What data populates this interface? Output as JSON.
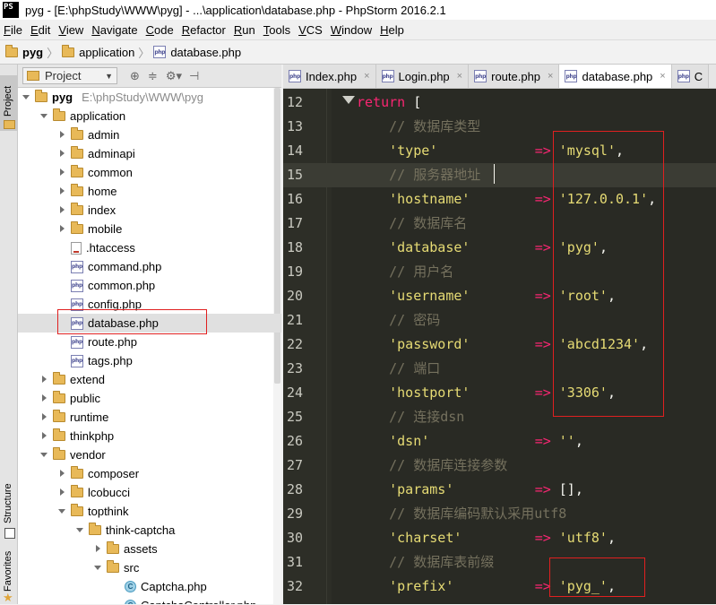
{
  "window": {
    "app_icon": "PS",
    "title": "pyg - [E:\\phpStudy\\WWW\\pyg] - ...\\application\\database.php - PhpStorm 2016.2.1"
  },
  "menu": [
    "File",
    "Edit",
    "View",
    "Navigate",
    "Code",
    "Refactor",
    "Run",
    "Tools",
    "VCS",
    "Window",
    "Help"
  ],
  "breadcrumb": [
    "pyg",
    "application",
    "database.php"
  ],
  "side_tabs": {
    "project": "Project",
    "structure": "Structure",
    "favorites": "Favorites"
  },
  "project_panel": {
    "title": "Project",
    "tree": [
      {
        "label": "pyg",
        "path": "E:\\phpStudy\\WWW\\pyg",
        "type": "folder",
        "expanded": true,
        "depth": 0
      },
      {
        "label": "application",
        "type": "folder",
        "expanded": true,
        "depth": 1
      },
      {
        "label": "admin",
        "type": "folder",
        "expanded": false,
        "depth": 2
      },
      {
        "label": "adminapi",
        "type": "folder",
        "expanded": false,
        "depth": 2
      },
      {
        "label": "common",
        "type": "folder",
        "expanded": false,
        "depth": 2
      },
      {
        "label": "home",
        "type": "folder",
        "expanded": false,
        "depth": 2
      },
      {
        "label": "index",
        "type": "folder",
        "expanded": false,
        "depth": 2
      },
      {
        "label": "mobile",
        "type": "folder",
        "expanded": false,
        "depth": 2
      },
      {
        "label": ".htaccess",
        "type": "htaccess",
        "depth": 2
      },
      {
        "label": "command.php",
        "type": "php",
        "depth": 2
      },
      {
        "label": "common.php",
        "type": "php",
        "depth": 2
      },
      {
        "label": "config.php",
        "type": "php",
        "depth": 2
      },
      {
        "label": "database.php",
        "type": "php",
        "depth": 2,
        "selected": true
      },
      {
        "label": "route.php",
        "type": "php",
        "depth": 2
      },
      {
        "label": "tags.php",
        "type": "php",
        "depth": 2
      },
      {
        "label": "extend",
        "type": "folder",
        "expanded": false,
        "depth": 1
      },
      {
        "label": "public",
        "type": "folder",
        "expanded": false,
        "depth": 1
      },
      {
        "label": "runtime",
        "type": "folder",
        "expanded": false,
        "depth": 1
      },
      {
        "label": "thinkphp",
        "type": "folder",
        "expanded": false,
        "depth": 1
      },
      {
        "label": "vendor",
        "type": "folder",
        "expanded": true,
        "depth": 1
      },
      {
        "label": "composer",
        "type": "folder",
        "expanded": false,
        "depth": 2
      },
      {
        "label": "lcobucci",
        "type": "folder",
        "expanded": false,
        "depth": 2
      },
      {
        "label": "topthink",
        "type": "folder",
        "expanded": true,
        "depth": 2
      },
      {
        "label": "think-captcha",
        "type": "folder",
        "expanded": true,
        "depth": 3
      },
      {
        "label": "assets",
        "type": "folder",
        "expanded": false,
        "depth": 4
      },
      {
        "label": "src",
        "type": "folder",
        "expanded": true,
        "depth": 4
      },
      {
        "label": "Captcha.php",
        "type": "class",
        "depth": 5
      },
      {
        "label": "CaptchaController.php",
        "type": "class",
        "depth": 5
      }
    ]
  },
  "tabs": [
    {
      "label": "Index.php",
      "active": false
    },
    {
      "label": "Login.php",
      "active": false
    },
    {
      "label": "route.php",
      "active": false
    },
    {
      "label": "database.php",
      "active": true
    },
    {
      "label": "C",
      "active": false
    }
  ],
  "code_lines": [
    {
      "n": "12",
      "tokens": [
        [
          "kw",
          "return"
        ],
        [
          "pl",
          " ["
        ]
      ]
    },
    {
      "n": "13",
      "tokens": [
        [
          "cm",
          "    // 数据库类型"
        ]
      ]
    },
    {
      "n": "14",
      "tokens": [
        [
          "str",
          "    'type'"
        ],
        [
          "pl",
          "            "
        ],
        [
          "op",
          "=>"
        ],
        [
          "pl",
          " "
        ],
        [
          "str",
          "'mysql'"
        ],
        [
          "pl",
          ","
        ]
      ]
    },
    {
      "n": "15",
      "tokens": [
        [
          "cm",
          "    // 服务器地址"
        ]
      ],
      "current": true
    },
    {
      "n": "16",
      "tokens": [
        [
          "str",
          "    'hostname'"
        ],
        [
          "pl",
          "        "
        ],
        [
          "op",
          "=>"
        ],
        [
          "pl",
          " "
        ],
        [
          "str",
          "'127.0.0.1'"
        ],
        [
          "pl",
          ","
        ]
      ]
    },
    {
      "n": "17",
      "tokens": [
        [
          "cm",
          "    // 数据库名"
        ]
      ]
    },
    {
      "n": "18",
      "tokens": [
        [
          "str",
          "    'database'"
        ],
        [
          "pl",
          "        "
        ],
        [
          "op",
          "=>"
        ],
        [
          "pl",
          " "
        ],
        [
          "str",
          "'pyg'"
        ],
        [
          "pl",
          ","
        ]
      ]
    },
    {
      "n": "19",
      "tokens": [
        [
          "cm",
          "    // 用户名"
        ]
      ]
    },
    {
      "n": "20",
      "tokens": [
        [
          "str",
          "    'username'"
        ],
        [
          "pl",
          "        "
        ],
        [
          "op",
          "=>"
        ],
        [
          "pl",
          " "
        ],
        [
          "str",
          "'root'"
        ],
        [
          "pl",
          ","
        ]
      ]
    },
    {
      "n": "21",
      "tokens": [
        [
          "cm",
          "    // 密码"
        ]
      ]
    },
    {
      "n": "22",
      "tokens": [
        [
          "str",
          "    'password'"
        ],
        [
          "pl",
          "        "
        ],
        [
          "op",
          "=>"
        ],
        [
          "pl",
          " "
        ],
        [
          "str",
          "'abcd1234'"
        ],
        [
          "pl",
          ","
        ]
      ]
    },
    {
      "n": "23",
      "tokens": [
        [
          "cm",
          "    // 端口"
        ]
      ]
    },
    {
      "n": "24",
      "tokens": [
        [
          "str",
          "    'hostport'"
        ],
        [
          "pl",
          "        "
        ],
        [
          "op",
          "=>"
        ],
        [
          "pl",
          " "
        ],
        [
          "str",
          "'3306'"
        ],
        [
          "pl",
          ","
        ]
      ]
    },
    {
      "n": "25",
      "tokens": [
        [
          "cm",
          "    // 连接dsn"
        ]
      ]
    },
    {
      "n": "26",
      "tokens": [
        [
          "str",
          "    'dsn'"
        ],
        [
          "pl",
          "             "
        ],
        [
          "op",
          "=>"
        ],
        [
          "pl",
          " "
        ],
        [
          "str",
          "''"
        ],
        [
          "pl",
          ","
        ]
      ]
    },
    {
      "n": "27",
      "tokens": [
        [
          "cm",
          "    // 数据库连接参数"
        ]
      ]
    },
    {
      "n": "28",
      "tokens": [
        [
          "str",
          "    'params'"
        ],
        [
          "pl",
          "          "
        ],
        [
          "op",
          "=>"
        ],
        [
          "pl",
          " [],"
        ]
      ]
    },
    {
      "n": "29",
      "tokens": [
        [
          "cm",
          "    // 数据库编码默认采用utf8"
        ]
      ]
    },
    {
      "n": "30",
      "tokens": [
        [
          "str",
          "    'charset'"
        ],
        [
          "pl",
          "         "
        ],
        [
          "op",
          "=>"
        ],
        [
          "pl",
          " "
        ],
        [
          "str",
          "'utf8'"
        ],
        [
          "pl",
          ","
        ]
      ]
    },
    {
      "n": "31",
      "tokens": [
        [
          "cm",
          "    // 数据库表前缀"
        ]
      ]
    },
    {
      "n": "32",
      "tokens": [
        [
          "str",
          "    'prefix'"
        ],
        [
          "pl",
          "          "
        ],
        [
          "op",
          "=>"
        ],
        [
          "pl",
          " "
        ],
        [
          "str",
          "'pyg_'"
        ],
        [
          "pl",
          ","
        ]
      ]
    }
  ],
  "colors": {
    "editor_bg": "#292a24",
    "keyword": "#f92672",
    "string": "#e6db74",
    "comment": "#75715e",
    "highlight_box": "#e02020",
    "selection_bg": "#e0e0e0"
  }
}
